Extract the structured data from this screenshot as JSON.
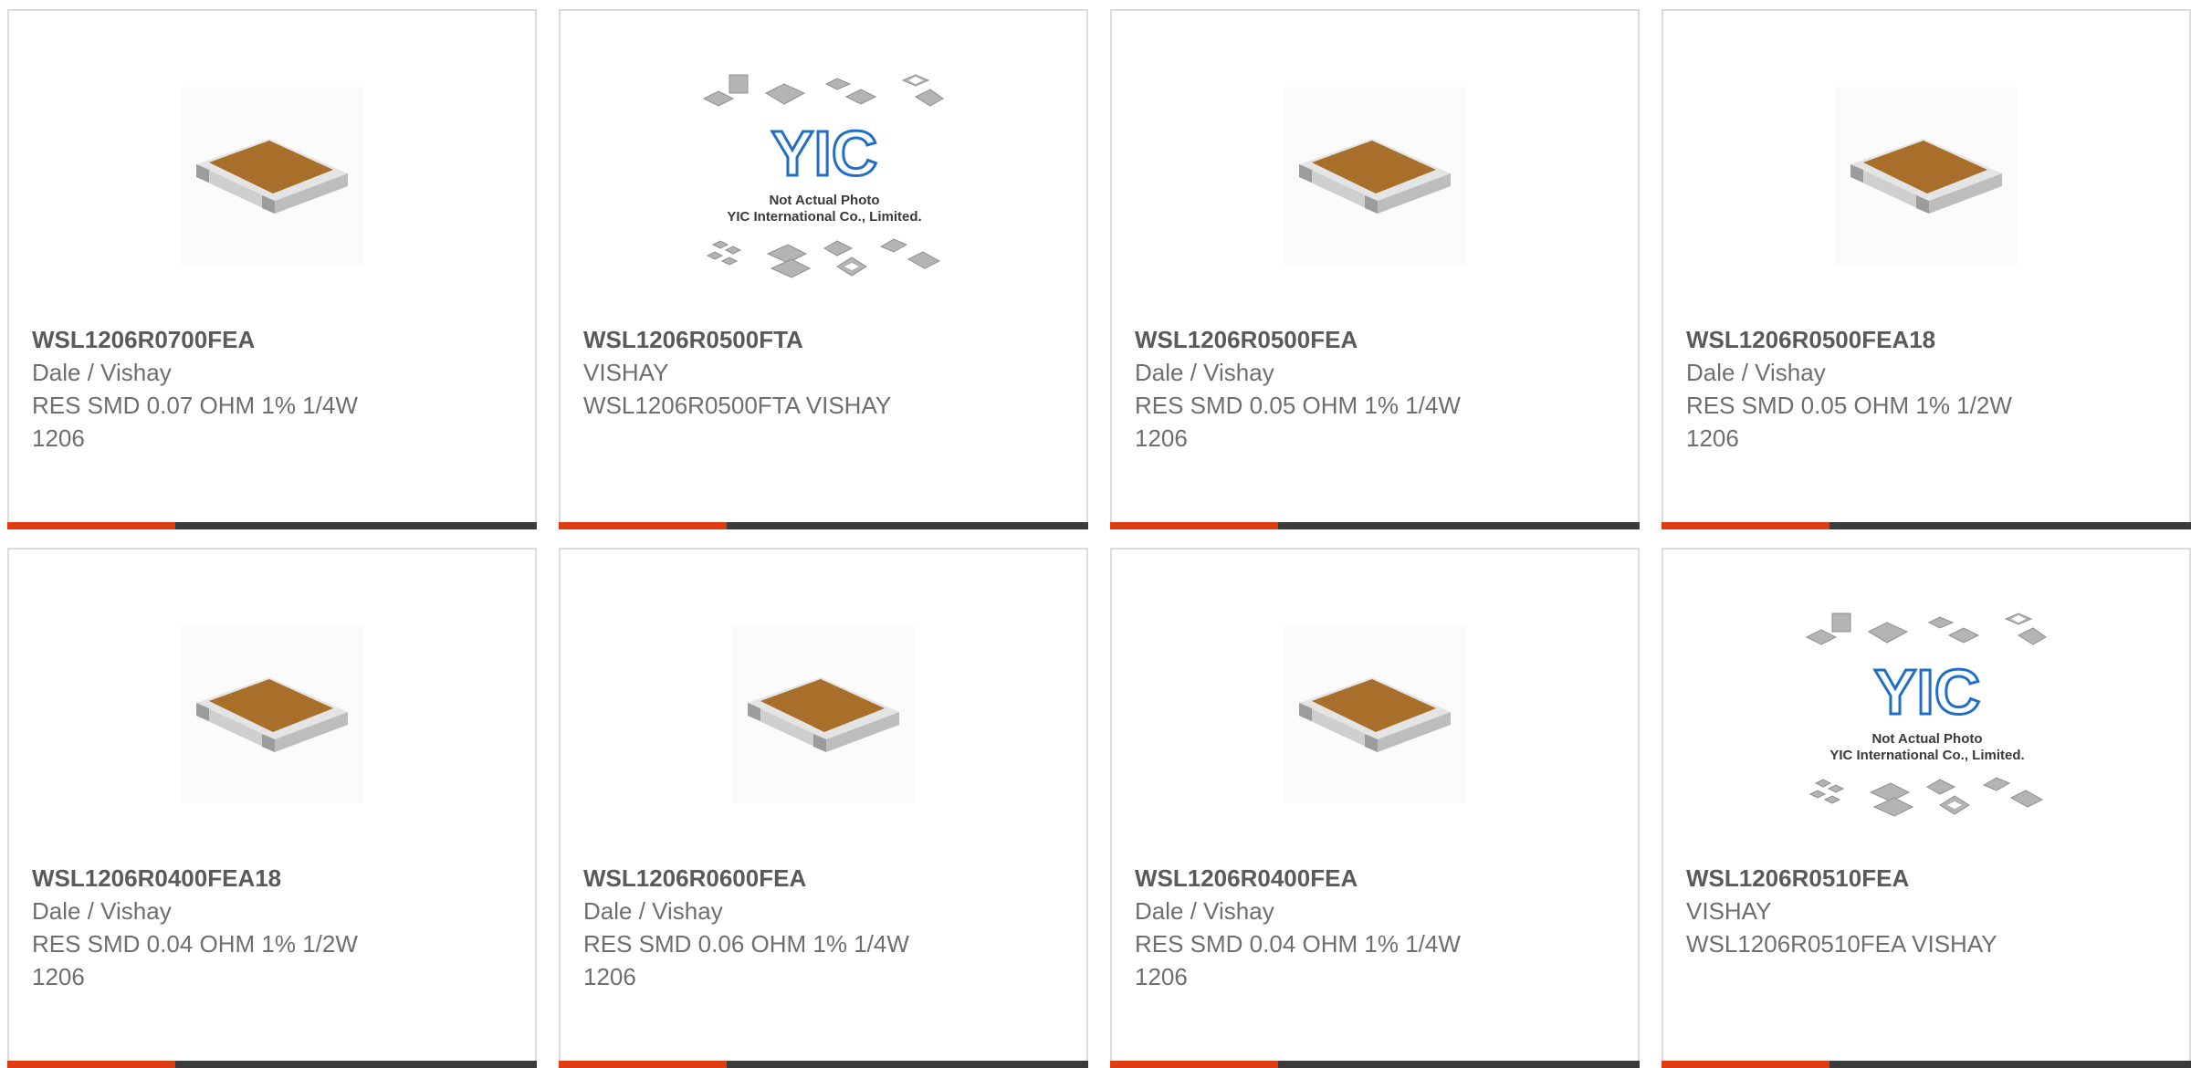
{
  "colors": {
    "accent": "#e03c13",
    "bar_dark": "#3b3b3b",
    "chip_body": "#a86f2a",
    "chip_end": "#d9d9d9",
    "logo_blue": "#1f6fc7"
  },
  "placeholder": {
    "line1": "Not Actual Photo",
    "line2": "YIC International Co., Limited.",
    "logo": "YIC"
  },
  "products": [
    {
      "part": "WSL1206R0700FEA",
      "maker": "Dale / Vishay",
      "desc": "RES SMD 0.07 OHM 1% 1/4W",
      "pkg": "1206",
      "image": "resistor-chip"
    },
    {
      "part": "WSL1206R0500FTA",
      "maker": "VISHAY",
      "desc": "WSL1206R0500FTA VISHAY",
      "pkg": "",
      "image": "not-actual-photo"
    },
    {
      "part": "WSL1206R0500FEA",
      "maker": "Dale / Vishay",
      "desc": "RES SMD 0.05 OHM 1% 1/4W",
      "pkg": "1206",
      "image": "resistor-chip"
    },
    {
      "part": "WSL1206R0500FEA18",
      "maker": "Dale / Vishay",
      "desc": "RES SMD 0.05 OHM 1% 1/2W",
      "pkg": "1206",
      "image": "resistor-chip"
    },
    {
      "part": "WSL1206R0400FEA18",
      "maker": "Dale / Vishay",
      "desc": "RES SMD 0.04 OHM 1% 1/2W",
      "pkg": "1206",
      "image": "resistor-chip"
    },
    {
      "part": "WSL1206R0600FEA",
      "maker": "Dale / Vishay",
      "desc": "RES SMD 0.06 OHM 1% 1/4W",
      "pkg": "1206",
      "image": "resistor-chip"
    },
    {
      "part": "WSL1206R0400FEA",
      "maker": "Dale / Vishay",
      "desc": "RES SMD 0.04 OHM 1% 1/4W",
      "pkg": "1206",
      "image": "resistor-chip"
    },
    {
      "part": "WSL1206R0510FEA",
      "maker": "VISHAY",
      "desc": "WSL1206R0510FEA VISHAY",
      "pkg": "",
      "image": "not-actual-photo"
    }
  ]
}
